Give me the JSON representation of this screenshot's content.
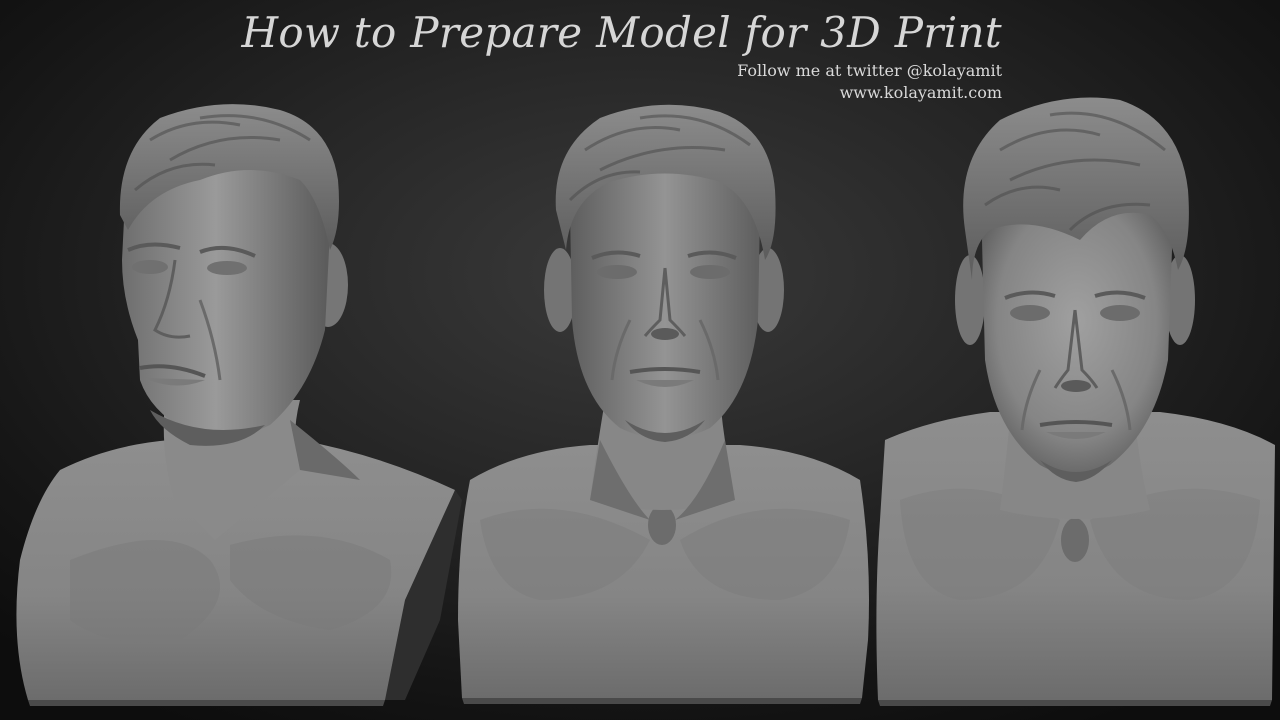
{
  "title": "How to Prepare Model for 3D Print",
  "credits": {
    "twitter": "Follow me at twitter @kolayamit",
    "website": "www.kolayamit.com"
  },
  "colors": {
    "background": "#1a1a1a",
    "clay": "#8a8a8a",
    "text": "#d6d6d6"
  }
}
